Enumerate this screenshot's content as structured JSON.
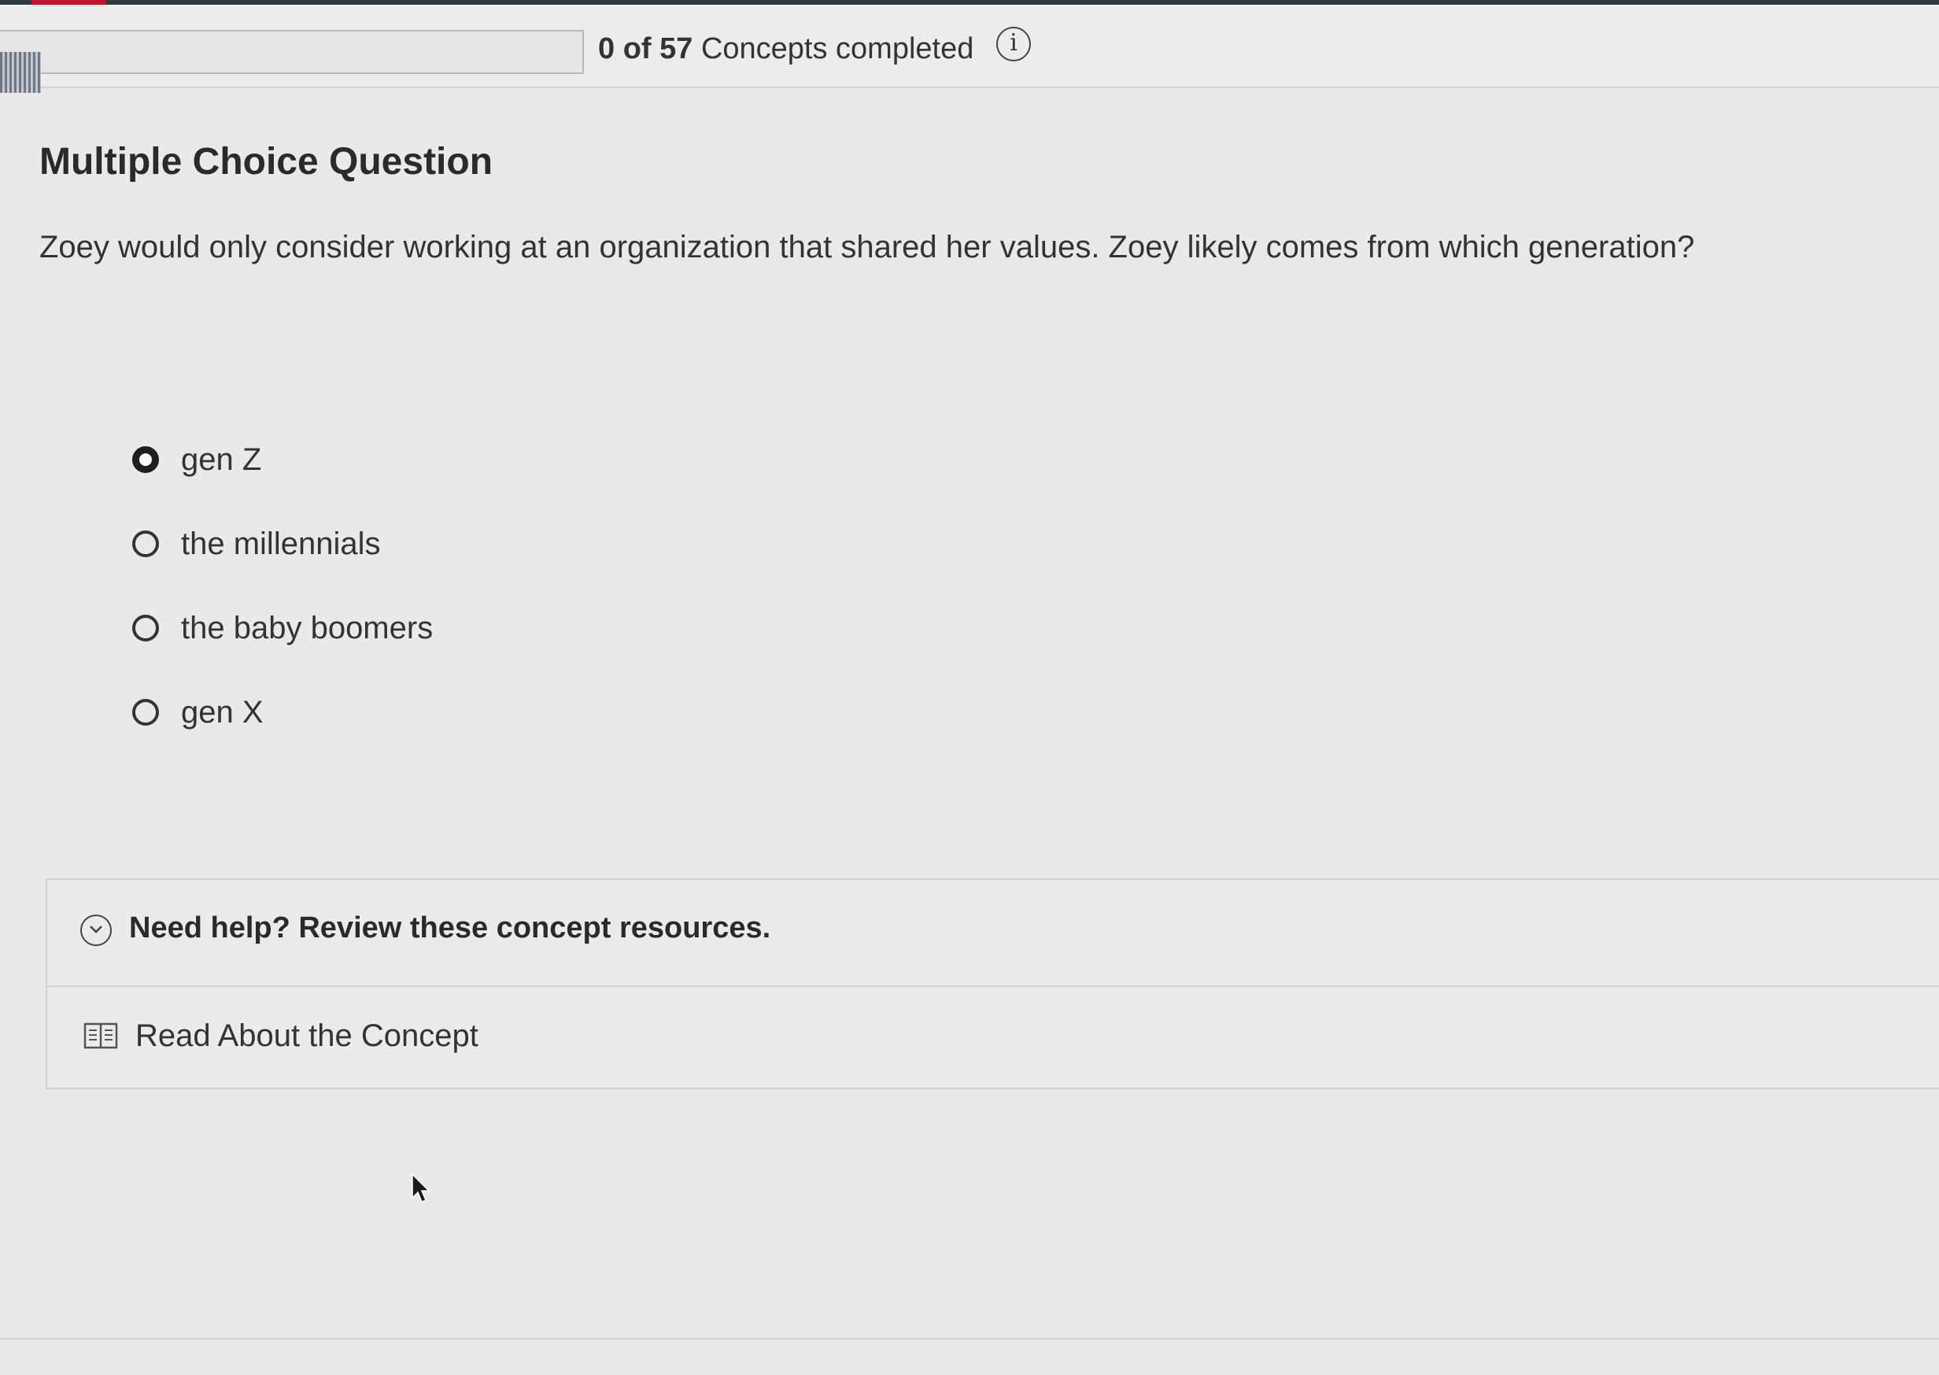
{
  "progress": {
    "completed_count": "0 of 57",
    "label_suffix": "Concepts completed",
    "completed": 0,
    "total": 57
  },
  "info_icon_glyph": "i",
  "question": {
    "type_label": "Multiple Choice Question",
    "prompt": "Zoey would only consider working at an organization that shared her values. Zoey likely comes from which generation?",
    "options": [
      {
        "label": "gen Z",
        "selected": true
      },
      {
        "label": "the millennials",
        "selected": false
      },
      {
        "label": "the baby boomers",
        "selected": false
      },
      {
        "label": "gen X",
        "selected": false
      }
    ]
  },
  "help": {
    "toggle_label": "Need help? Review these concept resources.",
    "resources": [
      {
        "label": "Read About the Concept",
        "icon": "book-icon"
      }
    ]
  },
  "colors": {
    "accent_red": "#c8102e",
    "page_bg": "#e9e9e7"
  }
}
